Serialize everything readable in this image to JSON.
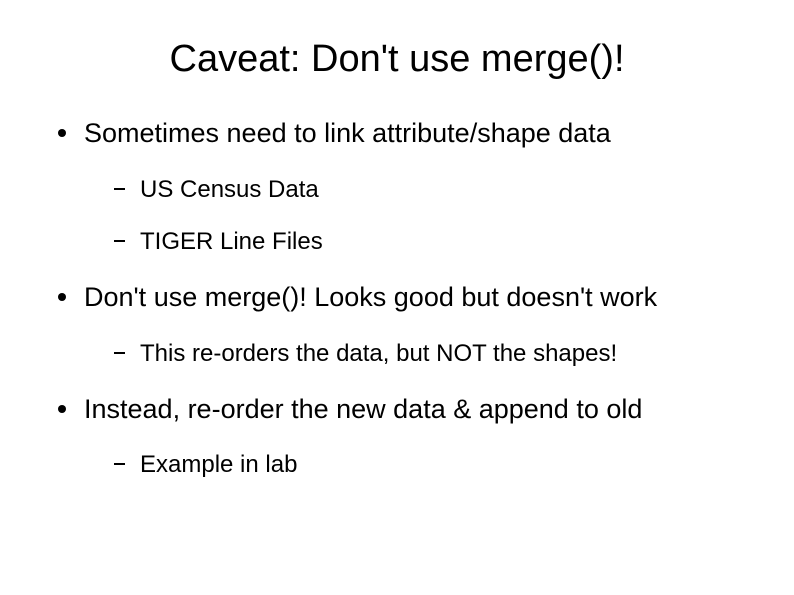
{
  "title": "Caveat: Don't use merge()!",
  "bullets": [
    {
      "text": "Sometimes need to link attribute/shape data",
      "children": [
        {
          "text": "US Census Data"
        },
        {
          "text": "TIGER Line Files"
        }
      ]
    },
    {
      "text": "Don't use merge()! Looks good but doesn't work",
      "children": [
        {
          "text": "This re-orders the data, but NOT the shapes!"
        }
      ]
    },
    {
      "text": "Instead, re-order the new data & append to old",
      "children": [
        {
          "text": "Example in lab"
        }
      ]
    }
  ]
}
